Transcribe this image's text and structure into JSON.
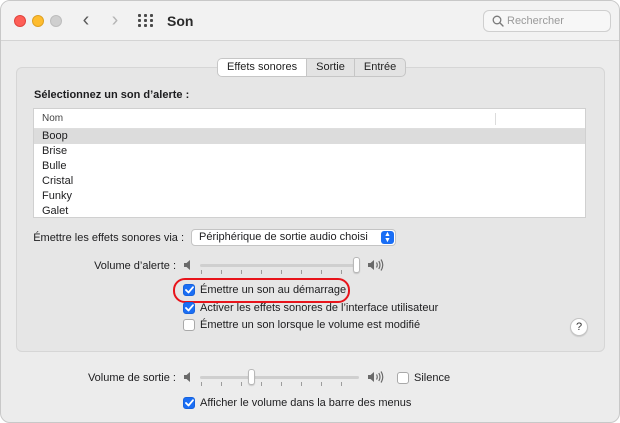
{
  "window": {
    "title": "Son",
    "nav_back": "‹",
    "nav_forward": "›",
    "search_placeholder": "Rechercher"
  },
  "tabs": [
    {
      "label": "Effets sonores",
      "active": true
    },
    {
      "label": "Sortie",
      "active": false
    },
    {
      "label": "Entrée",
      "active": false
    }
  ],
  "alert_section": {
    "title": "Sélectionnez un son d’alerte :",
    "column_header": "Nom",
    "sounds": [
      "Boop",
      "Brise",
      "Bulle",
      "Cristal",
      "Funky",
      "Galet"
    ],
    "selected": "Boop"
  },
  "effects_via": {
    "label": "Émettre les effets sonores via :",
    "value": "Périphérique de sortie audio choisi"
  },
  "alert_volume": {
    "label": "Volume d’alerte :",
    "level": 1.0
  },
  "options": [
    {
      "label": "Émettre un son au démarrage",
      "checked": true,
      "highlighted": true
    },
    {
      "label": "Activer les effets sonores de l’interface utilisateur",
      "checked": true
    },
    {
      "label": "Émettre un son lorsque le volume est modifié",
      "checked": false
    }
  ],
  "help_label": "?",
  "output_volume": {
    "label": "Volume de sortie :",
    "level": 0.31,
    "mute_label": "Silence",
    "mute_checked": false
  },
  "menu_bar_option": {
    "label": "Afficher le volume dans la barre des menus",
    "checked": true
  },
  "colors": {
    "accent": "#1a6ef5",
    "highlight_ring": "#e8141b",
    "close": "#fe5f57",
    "minimize": "#febc2e"
  }
}
